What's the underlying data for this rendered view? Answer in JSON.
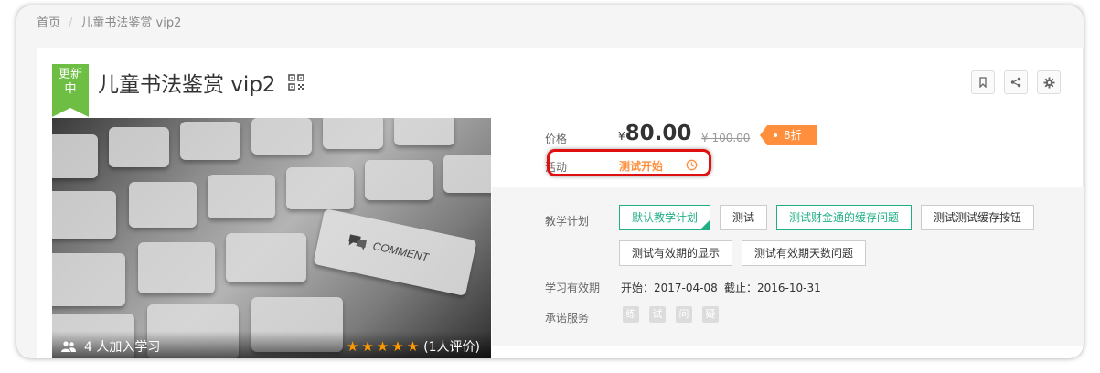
{
  "breadcrumb": {
    "home": "首页",
    "separator": "/",
    "current": "儿童书法鉴赏 vip2"
  },
  "course": {
    "status_badge_line1": "更新",
    "status_badge_line2": "中",
    "title": "儿童书法鉴赏 vip2",
    "cover_overlay_text": "COMMENT",
    "learners": "4 人加入学习",
    "rating_stars": 5,
    "rating_text": "(1人评价)"
  },
  "pricing": {
    "price_label": "价格",
    "currency": "¥",
    "price": "80.00",
    "original_price": "¥ 100.00",
    "discount": "8折",
    "activity_label": "活动",
    "activity_name": "测试开始"
  },
  "plans": {
    "label": "教学计划",
    "items": [
      "默认教学计划",
      "测试",
      "测试财金通的缓存问题",
      "测试测试缓存按钮",
      "测试有效期的显示",
      "测试有效期天数问题"
    ]
  },
  "validity": {
    "label": "学习有效期",
    "start": "开始：2017-04-08",
    "end": "截止：2016-10-31"
  },
  "services": {
    "label": "承诺服务",
    "items": [
      "练",
      "试",
      "问",
      "疑"
    ]
  },
  "colors": {
    "accent": "#1fae85",
    "badge_green": "#6fbe44",
    "discount_orange": "#ff8f3c",
    "highlight_red": "#e01010"
  }
}
